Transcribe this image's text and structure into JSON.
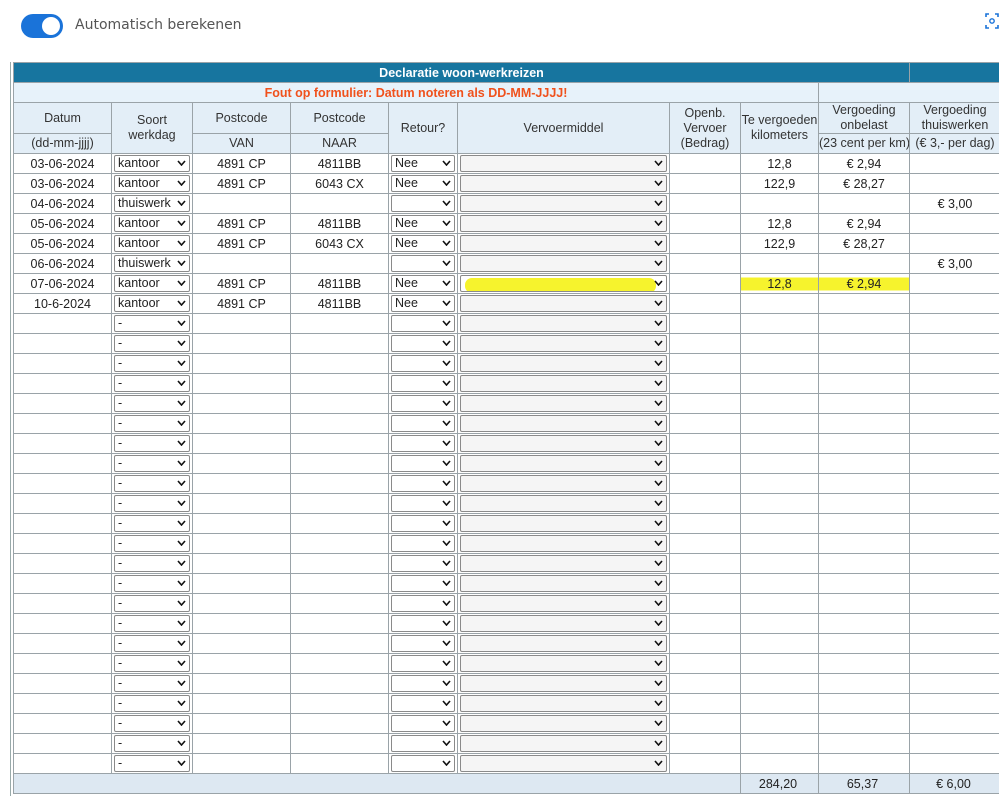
{
  "toggle": {
    "label": "Automatisch berekenen",
    "on": true
  },
  "sheet": {
    "title": "Declaratie woon-werkreizen",
    "error": "Fout op formulier: Datum noteren als DD-MM-JJJJ!",
    "headers": {
      "datum": "Datum",
      "datum_sub": "(dd-mm-jjjj)",
      "soort": "Soort werkdag",
      "postcode_van": "Postcode",
      "van": "VAN",
      "postcode_naar": "Postcode",
      "naar": "NAAR",
      "retour": "Retour?",
      "vervoermiddel": "Vervoermiddel",
      "openb": "Openb. Vervoer (Bedrag)",
      "km": "Te vergoeden kilometers",
      "onbelast": "Vergoeding onbelast",
      "onbelast_sub": "(23 cent per km)",
      "thuis": "Vergoeding thuiswerken",
      "thuis_sub": "(€ 3,- per dag)"
    },
    "rows": [
      {
        "datum": "03-06-2024",
        "soort": "kantoor",
        "van": "4891 CP",
        "naar": "4811BB",
        "retour": "Nee",
        "vervoer": "",
        "openb": "",
        "km": "12,8",
        "onbelast": "€ 2,94",
        "thuis": "",
        "highlight": false
      },
      {
        "datum": "03-06-2024",
        "soort": "kantoor",
        "van": "4891 CP",
        "naar": "6043 CX",
        "retour": "Nee",
        "vervoer": "",
        "openb": "",
        "km": "122,9",
        "onbelast": "€ 28,27",
        "thuis": "",
        "highlight": false
      },
      {
        "datum": "04-06-2024",
        "soort": "thuiswerk",
        "van": "",
        "naar": "",
        "retour": "",
        "vervoer": "",
        "openb": "",
        "km": "",
        "onbelast": "",
        "thuis": "€ 3,00",
        "highlight": false
      },
      {
        "datum": "05-06-2024",
        "soort": "kantoor",
        "van": "4891 CP",
        "naar": "4811BB",
        "retour": "Nee",
        "vervoer": "",
        "openb": "",
        "km": "12,8",
        "onbelast": "€ 2,94",
        "thuis": "",
        "highlight": false
      },
      {
        "datum": "05-06-2024",
        "soort": "kantoor",
        "van": "4891 CP",
        "naar": "6043 CX",
        "retour": "Nee",
        "vervoer": "",
        "openb": "",
        "km": "122,9",
        "onbelast": "€ 28,27",
        "thuis": "",
        "highlight": false
      },
      {
        "datum": "06-06-2024",
        "soort": "thuiswerk",
        "van": "",
        "naar": "",
        "retour": "",
        "vervoer": "",
        "openb": "",
        "km": "",
        "onbelast": "",
        "thuis": "€ 3,00",
        "highlight": false
      },
      {
        "datum": "07-06-2024",
        "soort": "kantoor",
        "van": "4891 CP",
        "naar": "4811BB",
        "retour": "Nee",
        "vervoer": "",
        "openb": "",
        "km": "12,8",
        "onbelast": "€ 2,94",
        "thuis": "",
        "highlight": true
      },
      {
        "datum": "10-6-2024",
        "soort": "kantoor",
        "van": "4891 CP",
        "naar": "4811BB",
        "retour": "Nee",
        "vervoer": "",
        "openb": "",
        "km": "",
        "onbelast": "",
        "thuis": "",
        "highlight": false
      },
      {
        "datum": "",
        "soort": "-",
        "van": "",
        "naar": "",
        "retour": "",
        "vervoer": "",
        "openb": "",
        "km": "",
        "onbelast": "",
        "thuis": "",
        "highlight": false
      },
      {
        "datum": "",
        "soort": "-",
        "van": "",
        "naar": "",
        "retour": "",
        "vervoer": "",
        "openb": "",
        "km": "",
        "onbelast": "",
        "thuis": "",
        "highlight": false
      },
      {
        "datum": "",
        "soort": "-",
        "van": "",
        "naar": "",
        "retour": "",
        "vervoer": "",
        "openb": "",
        "km": "",
        "onbelast": "",
        "thuis": "",
        "highlight": false
      },
      {
        "datum": "",
        "soort": "-",
        "van": "",
        "naar": "",
        "retour": "",
        "vervoer": "",
        "openb": "",
        "km": "",
        "onbelast": "",
        "thuis": "",
        "highlight": false
      },
      {
        "datum": "",
        "soort": "-",
        "van": "",
        "naar": "",
        "retour": "",
        "vervoer": "",
        "openb": "",
        "km": "",
        "onbelast": "",
        "thuis": "",
        "highlight": false
      },
      {
        "datum": "",
        "soort": "-",
        "van": "",
        "naar": "",
        "retour": "",
        "vervoer": "",
        "openb": "",
        "km": "",
        "onbelast": "",
        "thuis": "",
        "highlight": false
      },
      {
        "datum": "",
        "soort": "-",
        "van": "",
        "naar": "",
        "retour": "",
        "vervoer": "",
        "openb": "",
        "km": "",
        "onbelast": "",
        "thuis": "",
        "highlight": false
      },
      {
        "datum": "",
        "soort": "-",
        "van": "",
        "naar": "",
        "retour": "",
        "vervoer": "",
        "openb": "",
        "km": "",
        "onbelast": "",
        "thuis": "",
        "highlight": false
      },
      {
        "datum": "",
        "soort": "-",
        "van": "",
        "naar": "",
        "retour": "",
        "vervoer": "",
        "openb": "",
        "km": "",
        "onbelast": "",
        "thuis": "",
        "highlight": false
      },
      {
        "datum": "",
        "soort": "-",
        "van": "",
        "naar": "",
        "retour": "",
        "vervoer": "",
        "openb": "",
        "km": "",
        "onbelast": "",
        "thuis": "",
        "highlight": false
      },
      {
        "datum": "",
        "soort": "-",
        "van": "",
        "naar": "",
        "retour": "",
        "vervoer": "",
        "openb": "",
        "km": "",
        "onbelast": "",
        "thuis": "",
        "highlight": false
      },
      {
        "datum": "",
        "soort": "-",
        "van": "",
        "naar": "",
        "retour": "",
        "vervoer": "",
        "openb": "",
        "km": "",
        "onbelast": "",
        "thuis": "",
        "highlight": false
      },
      {
        "datum": "",
        "soort": "-",
        "van": "",
        "naar": "",
        "retour": "",
        "vervoer": "",
        "openb": "",
        "km": "",
        "onbelast": "",
        "thuis": "",
        "highlight": false
      },
      {
        "datum": "",
        "soort": "-",
        "van": "",
        "naar": "",
        "retour": "",
        "vervoer": "",
        "openb": "",
        "km": "",
        "onbelast": "",
        "thuis": "",
        "highlight": false
      },
      {
        "datum": "",
        "soort": "-",
        "van": "",
        "naar": "",
        "retour": "",
        "vervoer": "",
        "openb": "",
        "km": "",
        "onbelast": "",
        "thuis": "",
        "highlight": false
      },
      {
        "datum": "",
        "soort": "-",
        "van": "",
        "naar": "",
        "retour": "",
        "vervoer": "",
        "openb": "",
        "km": "",
        "onbelast": "",
        "thuis": "",
        "highlight": false
      },
      {
        "datum": "",
        "soort": "-",
        "van": "",
        "naar": "",
        "retour": "",
        "vervoer": "",
        "openb": "",
        "km": "",
        "onbelast": "",
        "thuis": "",
        "highlight": false
      },
      {
        "datum": "",
        "soort": "-",
        "van": "",
        "naar": "",
        "retour": "",
        "vervoer": "",
        "openb": "",
        "km": "",
        "onbelast": "",
        "thuis": "",
        "highlight": false
      },
      {
        "datum": "",
        "soort": "-",
        "van": "",
        "naar": "",
        "retour": "",
        "vervoer": "",
        "openb": "",
        "km": "",
        "onbelast": "",
        "thuis": "",
        "highlight": false
      },
      {
        "datum": "",
        "soort": "-",
        "van": "",
        "naar": "",
        "retour": "",
        "vervoer": "",
        "openb": "",
        "km": "",
        "onbelast": "",
        "thuis": "",
        "highlight": false
      },
      {
        "datum": "",
        "soort": "-",
        "van": "",
        "naar": "",
        "retour": "",
        "vervoer": "",
        "openb": "",
        "km": "",
        "onbelast": "",
        "thuis": "",
        "highlight": false
      },
      {
        "datum": "",
        "soort": "-",
        "van": "",
        "naar": "",
        "retour": "",
        "vervoer": "",
        "openb": "",
        "km": "",
        "onbelast": "",
        "thuis": "",
        "highlight": false
      },
      {
        "datum": "",
        "soort": "-",
        "van": "",
        "naar": "",
        "retour": "",
        "vervoer": "",
        "openb": "",
        "km": "",
        "onbelast": "",
        "thuis": "",
        "highlight": false
      }
    ],
    "totals": {
      "km": "284,20",
      "onbelast": "65,37",
      "thuis": "€ 6,00"
    }
  }
}
